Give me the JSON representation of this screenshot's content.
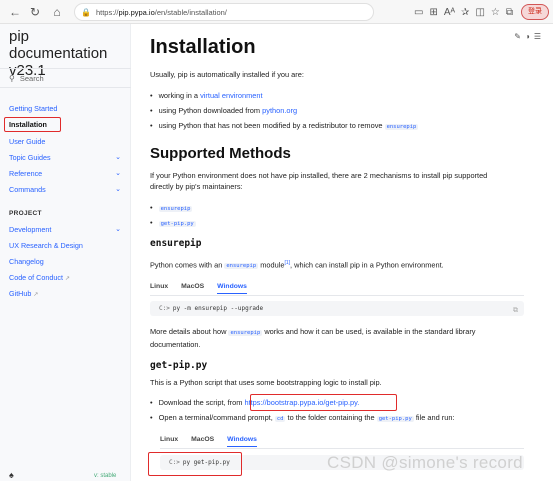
{
  "browser": {
    "url_prefix": "https://",
    "url_host": "pip.pypa.io",
    "url_path": "/en/stable/installation/",
    "login_label": "登录",
    "icons": [
      "back-arrow-icon",
      "refresh-icon",
      "home-icon",
      "lock-icon",
      "reader-mode-icon",
      "grid-icon",
      "font-size-icon",
      "translate-icon",
      "split-icon",
      "favorites-icon",
      "collections-icon"
    ]
  },
  "sidebar": {
    "brand": "pip documentation v23.1",
    "search_placeholder": "Search",
    "items": [
      {
        "label": "Getting Started",
        "chevron": false
      },
      {
        "label": "Installation",
        "chevron": false,
        "current": true
      },
      {
        "label": "User Guide",
        "chevron": false
      },
      {
        "label": "Topic Guides",
        "chevron": true
      },
      {
        "label": "Reference",
        "chevron": true
      },
      {
        "label": "Commands",
        "chevron": true
      }
    ],
    "section_label": "PROJECT",
    "project_items": [
      {
        "label": "Development",
        "chevron": true
      },
      {
        "label": "UX Research & Design",
        "chevron": false
      },
      {
        "label": "Changelog",
        "chevron": false
      },
      {
        "label": "Code of Conduct",
        "external": true
      },
      {
        "label": "GitHub",
        "external": true
      }
    ],
    "version_badge": "v: stable"
  },
  "main": {
    "title": "Installation",
    "intro": "Usually, pip is automatically installed if you are:",
    "bullets": {
      "b1_prefix": "working in a ",
      "b1_link": "virtual environment",
      "b2_prefix": "using Python downloaded from ",
      "b2_link": "python.org",
      "b3_prefix": "using Python that has not been modified by a redistributor to remove ",
      "b3_code": "ensurepip"
    },
    "supported_title": "Supported Methods",
    "supported_text_1": "If your Python environment does not have pip installed, there are 2 mechanisms to install pip supported",
    "supported_text_2": "directly by pip's maintainers:",
    "methods": [
      "ensurepip",
      "get-pip.py"
    ],
    "ensurepip_title": "ensurepip",
    "ensurepip_text_prefix": "Python comes with an ",
    "ensurepip_text_code": "ensurepip",
    "ensurepip_text_mid": " module",
    "ensurepip_text_sup": "[1]",
    "ensurepip_text_suffix": ", which can install pip in a Python environment.",
    "tabs": [
      "Linux",
      "MacOS",
      "Windows"
    ],
    "active_tab": "Windows",
    "ensurepip_cmd_prompt": "C:>",
    "ensurepip_cmd": "py -m ensurepip --upgrade",
    "more_details_prefix": "More details about how ",
    "more_details_code": "ensurepip",
    "more_details_suffix": " works and how it can be used, is available in the standard library",
    "more_details_line2": "documentation.",
    "getpip_title": "get-pip.py",
    "getpip_text": "This is a Python script that uses some bootstrapping logic to install pip.",
    "download_prefix": "Download the script, from ",
    "download_link": "https://bootstrap.pypa.io/get-pip.py.",
    "open_prefix": "Open a terminal/command prompt, ",
    "open_code1": "cd",
    "open_mid": " to the folder containing the ",
    "open_code2": "get-pip.py",
    "open_suffix": " file and run:",
    "getpip_cmd_prompt": "C:>",
    "getpip_cmd": "py get-pip.py"
  },
  "watermark": "CSDN @simone's record",
  "colors": {
    "accent": "#2962ff",
    "highlight": "#e02b2b"
  }
}
